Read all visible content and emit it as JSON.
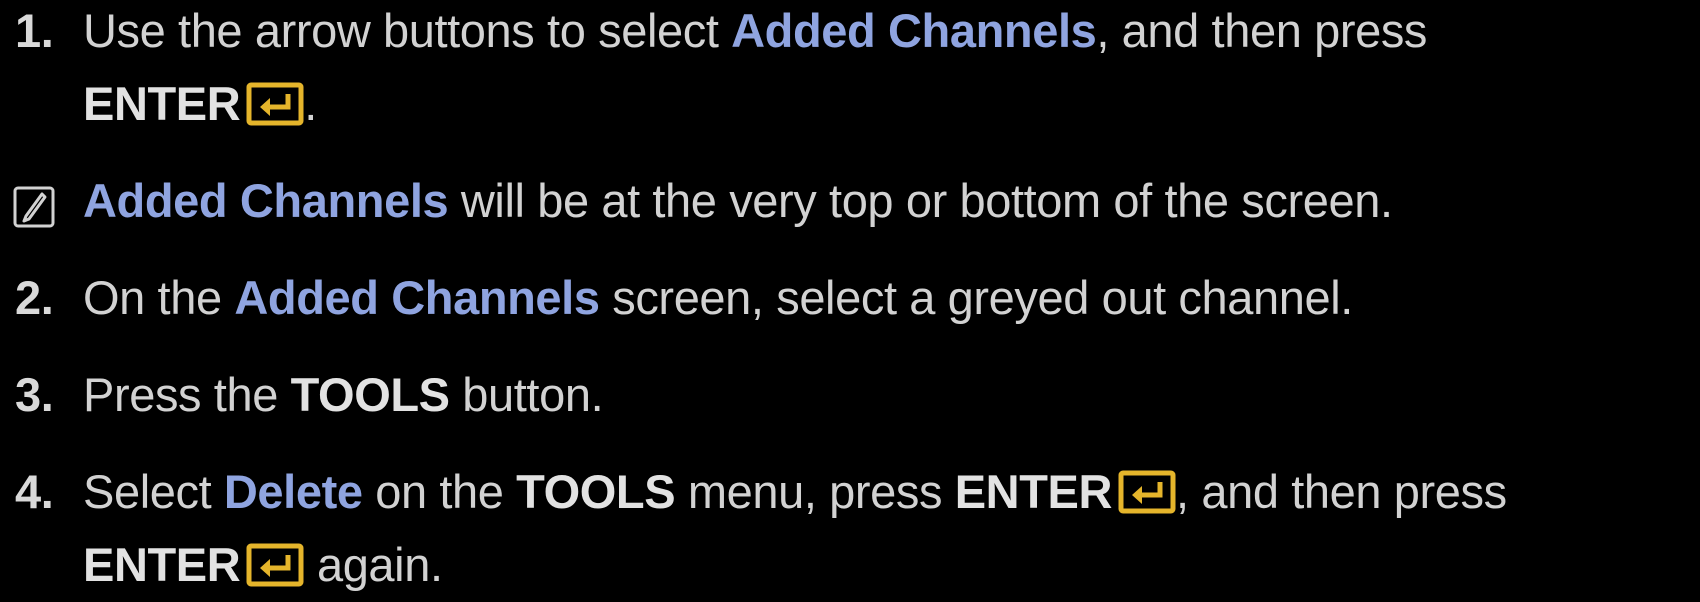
{
  "steps": {
    "s1": {
      "num": "1.",
      "t1": "Use the arrow buttons to select ",
      "h1": "Added Channels",
      "t2": ", and then press",
      "enter": "ENTER",
      "t3": "."
    },
    "note": {
      "h1": "Added Channels",
      "t1": " will be at the very top or bottom of the screen."
    },
    "s2": {
      "num": "2.",
      "t1": "On the ",
      "h1": "Added Channels",
      "t2": " screen, select a greyed out channel."
    },
    "s3": {
      "num": "3.",
      "t1": "Press the ",
      "b1": "TOOLS",
      "t2": " button."
    },
    "s4": {
      "num": "4.",
      "t1": "Select ",
      "h1": "Delete",
      "t2": " on the ",
      "b1": "TOOLS",
      "t3": " menu, press ",
      "enter1": "ENTER",
      "t4": ", and then press",
      "enter2": "ENTER",
      "t5": " again."
    }
  },
  "icons": {
    "enter": "enter-icon",
    "note": "note-icon"
  },
  "colors": {
    "background": "#000000",
    "text": "#d2d2d2",
    "highlight": "#8fa4e0",
    "enter_icon": "#e5b52b"
  }
}
